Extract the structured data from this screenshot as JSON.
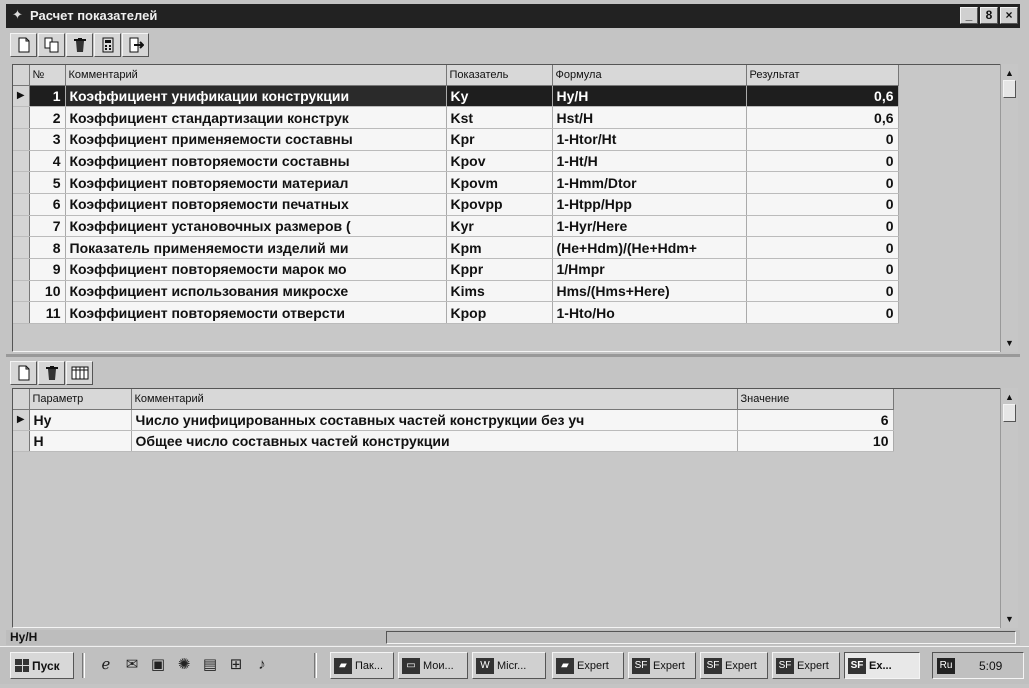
{
  "window": {
    "title": "Расчет показателей",
    "app_icon": "sf-logo-icon",
    "controls": [
      "_",
      "8",
      "×"
    ]
  },
  "top_toolbar": {
    "buttons": [
      "new-document-icon",
      "copy-document-icon",
      "delete-trash-icon",
      "calculator-icon",
      "exit-icon"
    ]
  },
  "top_grid": {
    "columns": [
      "№",
      "Комментарий",
      "Показатель",
      "Формула",
      "Результат"
    ],
    "selected_row": 0,
    "rows": [
      {
        "num": "1",
        "comment": "Коэффициент унификации конструкции",
        "indicator": "Ky",
        "formula": "Hy/H",
        "result": "0,6"
      },
      {
        "num": "2",
        "comment": "Коэффициент стандартизации конструк",
        "indicator": "Kst",
        "formula": "Hst/H",
        "result": "0,6"
      },
      {
        "num": "3",
        "comment": "Коэффициент применяемости составны",
        "indicator": "Kpr",
        "formula": "1-Htor/Ht",
        "result": "0"
      },
      {
        "num": "4",
        "comment": "Коэффициент повторяемости составны",
        "indicator": "Kpov",
        "formula": "1-Ht/H",
        "result": "0"
      },
      {
        "num": "5",
        "comment": "Коэффициент повторяемости материал",
        "indicator": "Kpovm",
        "formula": "1-Hmm/Dtor",
        "result": "0"
      },
      {
        "num": "6",
        "comment": "Коэффициент повторяемости печатных",
        "indicator": "Kpovpp",
        "formula": "1-Htpp/Hpp",
        "result": "0"
      },
      {
        "num": "7",
        "comment": "Коэффициент установочных размеров (",
        "indicator": "Kyr",
        "formula": "1-Hyr/Here",
        "result": "0"
      },
      {
        "num": "8",
        "comment": "Показатель применяемости изделий ми",
        "indicator": "Kpm",
        "formula": "(He+Hdm)/(He+Hdm+",
        "result": "0"
      },
      {
        "num": "9",
        "comment": "Коэффициент повторяемости марок мо",
        "indicator": "Kppr",
        "formula": "1/Hmpr",
        "result": "0"
      },
      {
        "num": "10",
        "comment": "Коэффициент использования микросхе",
        "indicator": "Kims",
        "formula": "Hms/(Hms+Here)",
        "result": "0"
      },
      {
        "num": "11",
        "comment": "Коэффициент повторяемости отверсти",
        "indicator": "Kpop",
        "formula": "1-Hto/Ho",
        "result": "0"
      }
    ]
  },
  "bottom_toolbar": {
    "buttons": [
      "new-document-icon",
      "delete-trash-icon",
      "table-grid-icon"
    ]
  },
  "bottom_grid": {
    "columns": [
      "Параметр",
      "Комментарий",
      "Значение"
    ],
    "rows": [
      {
        "param": "Hy",
        "comment": "Число унифицированных составных частей конструкции без уч",
        "value": "6"
      },
      {
        "param": "H",
        "comment": "Общее число составных частей конструкции",
        "value": "10"
      }
    ]
  },
  "statusbar": {
    "text": "Hy/H"
  },
  "taskbar": {
    "start_label": "Пуск",
    "quick_launch": [
      "internet-explorer-icon",
      "outlook-icon",
      "desktop-icon",
      "channels-icon",
      "mail-icon",
      "network-icon",
      "media-icon"
    ],
    "tasks": [
      {
        "label": "Пак...",
        "icon": "folder-icon"
      },
      {
        "label": "Мои...",
        "icon": "my-computer-icon"
      },
      {
        "label": "Micr...",
        "icon": "word-icon"
      },
      {
        "label": "Expert",
        "icon": "folder-icon"
      },
      {
        "label": "Expert",
        "icon": "sf-logo-icon"
      },
      {
        "label": "Expert",
        "icon": "sf-logo-icon"
      },
      {
        "label": "Expert",
        "icon": "sf-logo-icon"
      },
      {
        "label": "Ex...",
        "icon": "sf-logo-icon",
        "active": true
      }
    ],
    "tray": {
      "language": "Ru",
      "clock": "5:09"
    }
  }
}
